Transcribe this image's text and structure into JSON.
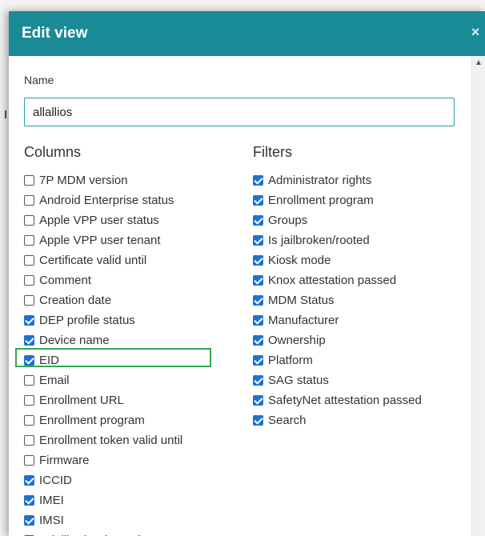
{
  "dialog": {
    "title": "Edit view",
    "close_glyph": "×"
  },
  "name": {
    "label": "Name",
    "value": "allallios"
  },
  "columns": {
    "heading": "Columns",
    "items": [
      {
        "label": "7P MDM version",
        "checked": false
      },
      {
        "label": "Android Enterprise status",
        "checked": false
      },
      {
        "label": "Apple VPP user status",
        "checked": false
      },
      {
        "label": "Apple VPP user tenant",
        "checked": false
      },
      {
        "label": "Certificate valid until",
        "checked": false
      },
      {
        "label": "Comment",
        "checked": false
      },
      {
        "label": "Creation date",
        "checked": false
      },
      {
        "label": "DEP profile status",
        "checked": true
      },
      {
        "label": "Device name",
        "checked": true
      },
      {
        "label": "EID",
        "checked": true
      },
      {
        "label": "Email",
        "checked": false
      },
      {
        "label": "Enrollment URL",
        "checked": false
      },
      {
        "label": "Enrollment program",
        "checked": false
      },
      {
        "label": "Enrollment token valid until",
        "checked": false
      },
      {
        "label": "Firmware",
        "checked": false
      },
      {
        "label": "ICCID",
        "checked": true
      },
      {
        "label": "IMEI",
        "checked": true
      },
      {
        "label": "IMSI",
        "checked": true
      },
      {
        "label": "Is jailbroken/rooted",
        "checked": false
      }
    ]
  },
  "filters": {
    "heading": "Filters",
    "items": [
      {
        "label": "Administrator rights",
        "checked": true
      },
      {
        "label": "Enrollment program",
        "checked": true
      },
      {
        "label": "Groups",
        "checked": true
      },
      {
        "label": "Is jailbroken/rooted",
        "checked": true
      },
      {
        "label": "Kiosk mode",
        "checked": true
      },
      {
        "label": "Knox attestation passed",
        "checked": true
      },
      {
        "label": "MDM Status",
        "checked": true
      },
      {
        "label": "Manufacturer",
        "checked": true
      },
      {
        "label": "Ownership",
        "checked": true
      },
      {
        "label": "Platform",
        "checked": true
      },
      {
        "label": "SAG status",
        "checked": true
      },
      {
        "label": "SafetyNet attestation passed",
        "checked": true
      },
      {
        "label": "Search",
        "checked": true
      }
    ]
  },
  "colors": {
    "header": "#1a8a97",
    "checkbox_checked": "#1b72d6",
    "highlight": "#34a853"
  },
  "icons": {
    "close": "close-icon",
    "scroll_up": "chevron-up-icon",
    "check": "check-icon"
  }
}
